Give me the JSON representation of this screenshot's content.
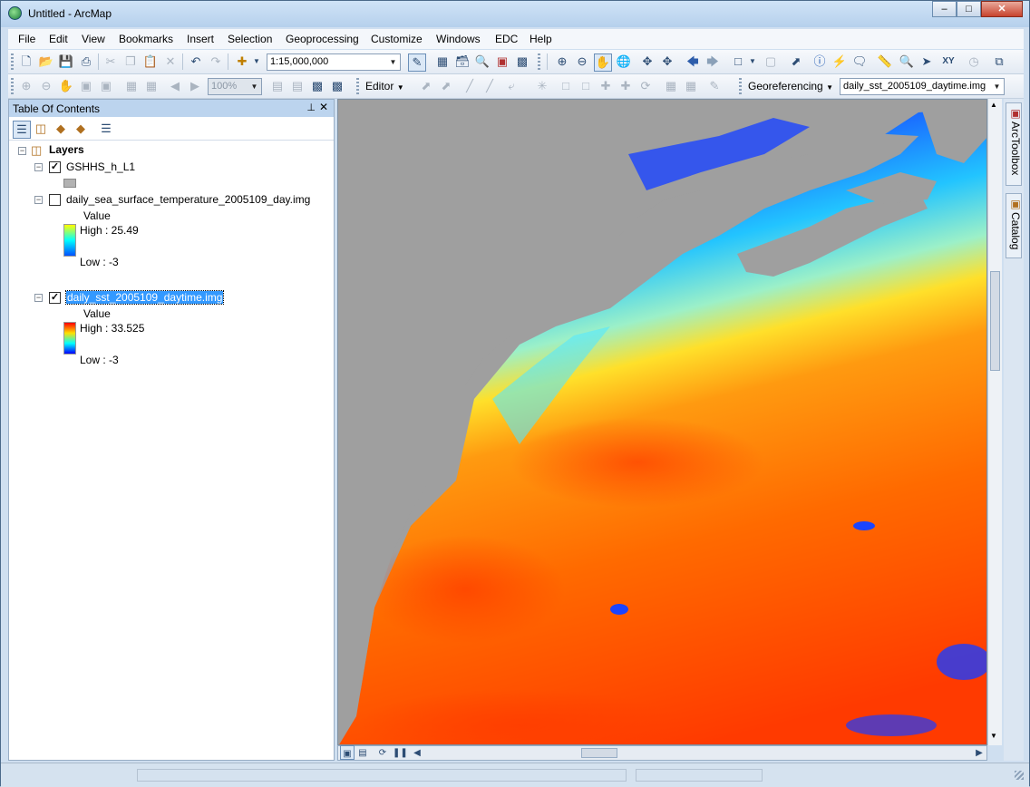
{
  "window": {
    "title": "Untitled - ArcMap"
  },
  "menu": [
    "File",
    "Edit",
    "View",
    "Bookmarks",
    "Insert",
    "Selection",
    "Geoprocessing",
    "Customize",
    "Windows",
    "EDC",
    "Help"
  ],
  "toolbar": {
    "scale_value": "1:15,000,000",
    "zoom_percent": "100%",
    "editor_label": "Editor",
    "georef_label": "Georeferencing",
    "georef_layer": "daily_sst_2005109_daytime.img"
  },
  "toc": {
    "title": "Table Of Contents",
    "root_label": "Layers",
    "layers": [
      {
        "name": "GSHHS_h_L1",
        "checked": true
      },
      {
        "name": "daily_sea_surface_temperature_2005109_day.img",
        "checked": false,
        "legend_title": "Value",
        "high": "High : 25.49",
        "low": "Low : -3"
      },
      {
        "name": "daily_sst_2005109_daytime.img",
        "checked": true,
        "selected": true,
        "legend_title": "Value",
        "high": "High : 33.525",
        "low": "Low : -3"
      }
    ]
  },
  "side_tabs": [
    "ArcToolbox",
    "Catalog"
  ],
  "icons": [
    "new-doc-icon",
    "open-icon",
    "save-icon",
    "print-icon",
    "cut-icon",
    "copy-icon",
    "paste-icon",
    "delete-icon",
    "undo-icon",
    "redo-icon",
    "add-data-icon",
    "zoom-in-icon",
    "zoom-out-icon",
    "pan-icon",
    "globe-icon",
    "identify-icon",
    "measure-icon",
    "find-icon"
  ]
}
